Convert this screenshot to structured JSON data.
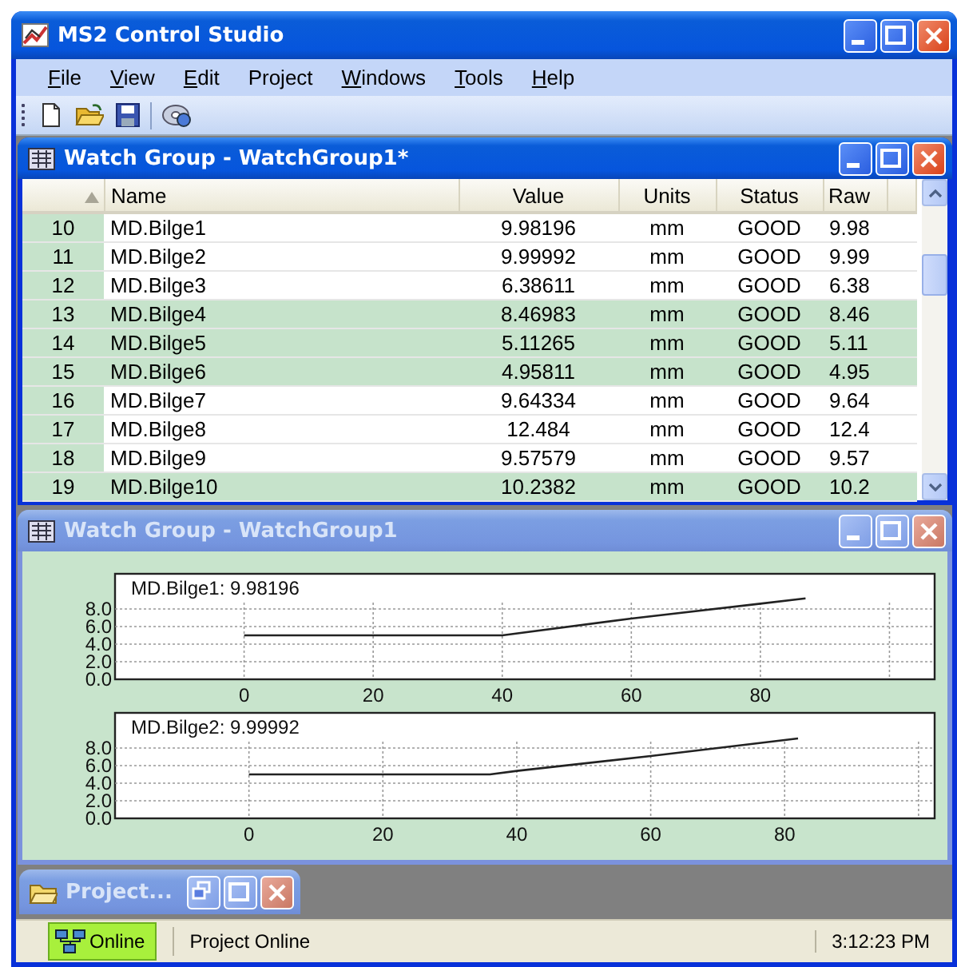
{
  "window": {
    "title": "MS2 Control Studio",
    "active": true
  },
  "menu": [
    {
      "label": "File",
      "mnemonic": true
    },
    {
      "label": "View",
      "mnemonic": true
    },
    {
      "label": "Edit",
      "mnemonic": true
    },
    {
      "label": "Project",
      "mnemonic": false
    },
    {
      "label": "Windows",
      "mnemonic": true
    },
    {
      "label": "Tools",
      "mnemonic": true
    },
    {
      "label": "Help",
      "mnemonic": true
    }
  ],
  "toolbar": [
    {
      "kind": "new"
    },
    {
      "kind": "open"
    },
    {
      "kind": "save"
    },
    {
      "kind": "separator"
    },
    {
      "kind": "disc"
    }
  ],
  "watch_table_window": {
    "title": "Watch Group - WatchGroup1*",
    "active": true,
    "table": {
      "columns": [
        "Name",
        "Value",
        "Units",
        "Status",
        "Raw"
      ],
      "rows": [
        {
          "number": "10",
          "name": "MD.Bilge1",
          "value": "9.98196",
          "units": "mm",
          "status": "GOOD",
          "raw": "9.98",
          "selected": false
        },
        {
          "number": "11",
          "name": "MD.Bilge2",
          "value": "9.99992",
          "units": "mm",
          "status": "GOOD",
          "raw": "9.99",
          "selected": false
        },
        {
          "number": "12",
          "name": "MD.Bilge3",
          "value": "6.38611",
          "units": "mm",
          "status": "GOOD",
          "raw": "6.38",
          "selected": false
        },
        {
          "number": "13",
          "name": "MD.Bilge4",
          "value": "8.46983",
          "units": "mm",
          "status": "GOOD",
          "raw": "8.46",
          "selected": true
        },
        {
          "number": "14",
          "name": "MD.Bilge5",
          "value": "5.11265",
          "units": "mm",
          "status": "GOOD",
          "raw": "5.11",
          "selected": true
        },
        {
          "number": "15",
          "name": "MD.Bilge6",
          "value": "4.95811",
          "units": "mm",
          "status": "GOOD",
          "raw": "4.95",
          "selected": true
        },
        {
          "number": "16",
          "name": "MD.Bilge7",
          "value": "9.64334",
          "units": "mm",
          "status": "GOOD",
          "raw": "9.64",
          "selected": false
        },
        {
          "number": "17",
          "name": "MD.Bilge8",
          "value": "12.484",
          "units": "mm",
          "status": "GOOD",
          "raw": "12.4",
          "selected": false
        },
        {
          "number": "18",
          "name": "MD.Bilge9",
          "value": "9.57579",
          "units": "mm",
          "status": "GOOD",
          "raw": "9.57",
          "selected": false
        },
        {
          "number": "19",
          "name": "MD.Bilge10",
          "value": "10.2382",
          "units": "mm",
          "status": "GOOD",
          "raw": "10.2",
          "selected": true
        }
      ]
    }
  },
  "watch_chart_window": {
    "title": "Watch Group - WatchGroup1",
    "active": false,
    "charts": [
      {
        "chart_data": {
          "type": "line",
          "title": "MD.Bilge1: 9.98196",
          "x": [
            0,
            40,
            60,
            80,
            87
          ],
          "values": [
            5.0,
            5.0,
            6.9,
            8.6,
            9.2
          ],
          "xlim": [
            -20,
            107
          ],
          "ylim": [
            0,
            12
          ],
          "grid": true,
          "ref_lines": [
            {
              "axis": "x",
              "value": 100
            }
          ],
          "xticks": [
            0,
            20,
            40,
            60,
            80
          ],
          "yticks": [
            {
              "value": 0,
              "label": "0.0"
            },
            {
              "value": 2,
              "label": "2.0"
            },
            {
              "value": 4,
              "label": "4.0"
            },
            {
              "value": 6,
              "label": "6.0"
            },
            {
              "value": 8,
              "label": "8.0"
            }
          ]
        }
      },
      {
        "chart_data": {
          "type": "line",
          "title": "MD.Bilge2: 9.99992",
          "x": [
            0,
            36,
            40,
            60,
            80,
            82
          ],
          "values": [
            5.0,
            5.0,
            5.4,
            7.1,
            8.9,
            9.1
          ],
          "xlim": [
            -20,
            102.4
          ],
          "ylim": [
            0,
            12
          ],
          "grid": true,
          "ref_lines": [
            {
              "axis": "x",
              "value": 100
            }
          ],
          "xticks": [
            0,
            20,
            40,
            60,
            80
          ],
          "yticks": [
            {
              "value": 0,
              "label": "0.0"
            },
            {
              "value": 2,
              "label": "2.0"
            },
            {
              "value": 4,
              "label": "4.0"
            },
            {
              "value": 6,
              "label": "6.0"
            },
            {
              "value": 8,
              "label": "8.0"
            }
          ]
        }
      }
    ]
  },
  "minimized_window": {
    "title": "Project..."
  },
  "status_bar": {
    "connection": "Online",
    "connected": true,
    "message": "Project Online",
    "time": "3:12:23 PM"
  }
}
